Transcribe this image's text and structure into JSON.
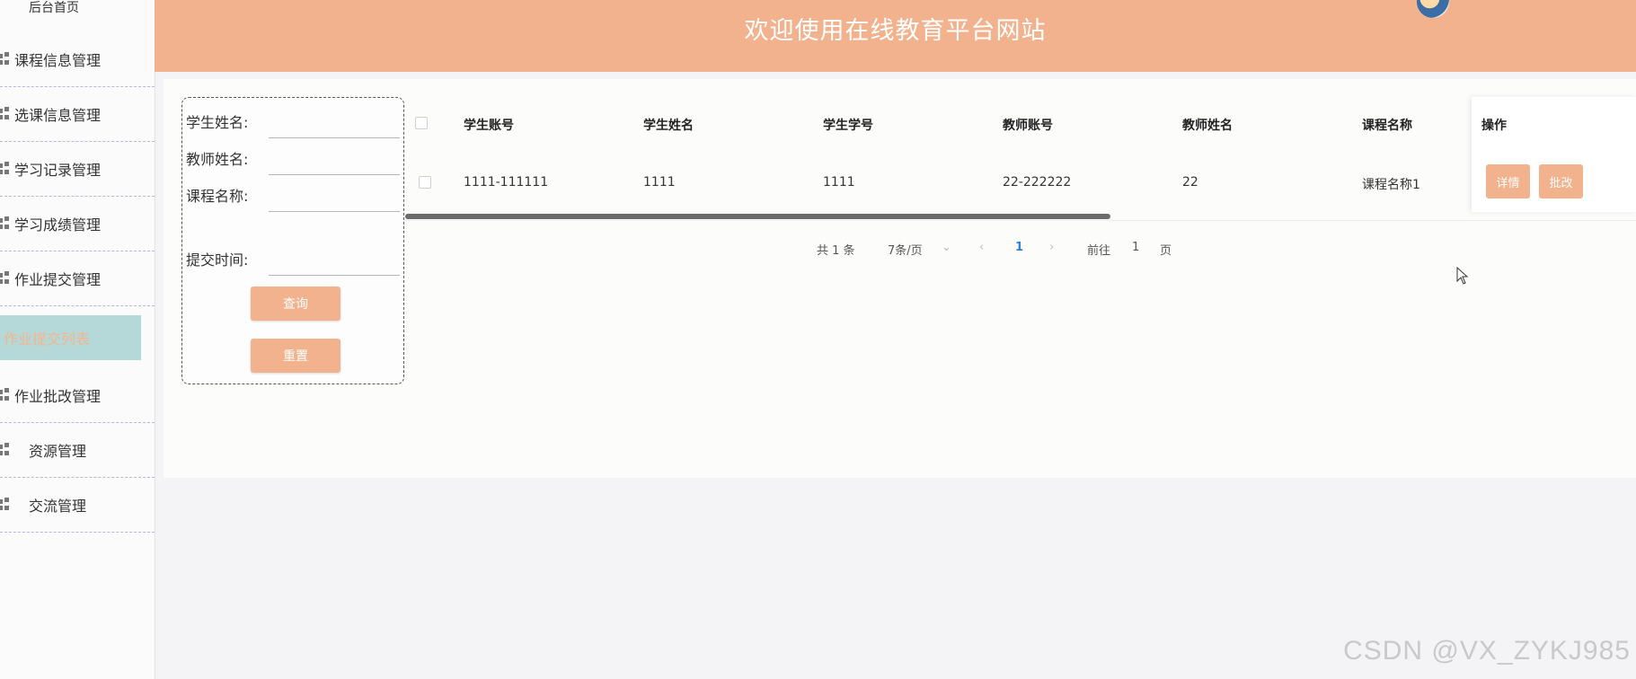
{
  "sidebar": {
    "home": "后台首页",
    "items": [
      {
        "label": "课程信息管理"
      },
      {
        "label": "选课信息管理"
      },
      {
        "label": "学习记录管理"
      },
      {
        "label": "学习成绩管理"
      },
      {
        "label": "作业提交管理"
      },
      {
        "label": "作业批改管理"
      },
      {
        "label": "资源管理"
      },
      {
        "label": "交流管理"
      }
    ],
    "active_sub": "作业提交列表"
  },
  "header": {
    "title": "欢迎使用在线教育平台网站"
  },
  "search": {
    "student_name_label": "学生姓名:",
    "teacher_name_label": "教师姓名:",
    "course_name_label": "课程名称:",
    "submit_time_label": "提交时间:",
    "query_button": "查询",
    "reset_button": "重置"
  },
  "table": {
    "columns": [
      "学生账号",
      "学生姓名",
      "学生学号",
      "教师账号",
      "教师姓名",
      "课程名称",
      "操作"
    ],
    "rows": [
      [
        "1111-111111",
        "1111",
        "1111",
        "22-222222",
        "22",
        "课程名称1"
      ]
    ],
    "actions": {
      "detail": "详情",
      "grade": "批改"
    }
  },
  "pagination": {
    "total": "共 1 条",
    "page_size": "7条/页",
    "current": "1",
    "goto_label": "前往",
    "goto_value": "1",
    "page_suffix": "页"
  },
  "watermark": "CSDN @VX_ZYKJ985",
  "colors": {
    "accent": "#f2b28e",
    "active_bg": "#b5d8d8",
    "link": "#2f7fd9"
  }
}
